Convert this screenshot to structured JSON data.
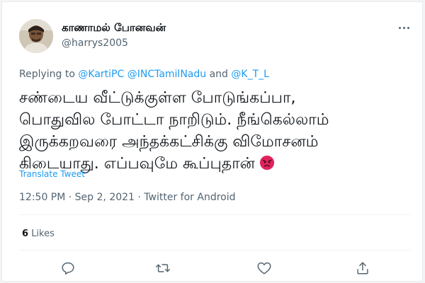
{
  "author": {
    "display_name": "காணாமல் போனவன்",
    "handle": "@harrys2005",
    "avatar_icon": "profile-photo"
  },
  "reply": {
    "prefix": "Replying to",
    "mention_1": "@KartiPC",
    "mention_2": "@INCTamilNadu",
    "joiner": "and",
    "mention_3": "@K_T_L"
  },
  "tweet": {
    "lines": [
      "சண்டைய வீட்டுக்குள்ள போடுங்கப்பா,",
      "பொதுவில போட்டா நாறிடும். நீங்கெல்லாம்",
      "இருக்கறவரை அந்தக்கட்சிக்கு விமோசனம்",
      "கிடையாது. எப்பவுமே கூப்புதான்"
    ],
    "emoji_icon": "angry-face-emoji",
    "translate_label": "Translate Tweet",
    "timestamp": "12:50 PM · Sep 2, 2021 · Twitter for Android"
  },
  "stats": {
    "likes_count": "6",
    "likes_label": "Likes"
  },
  "actions": [
    "reply-icon",
    "retweet-icon",
    "like-icon",
    "share-icon"
  ],
  "colors": {
    "link": "#1d9bf0",
    "text": "#0f1419",
    "muted": "#536471",
    "emoji": "#e0245e"
  }
}
